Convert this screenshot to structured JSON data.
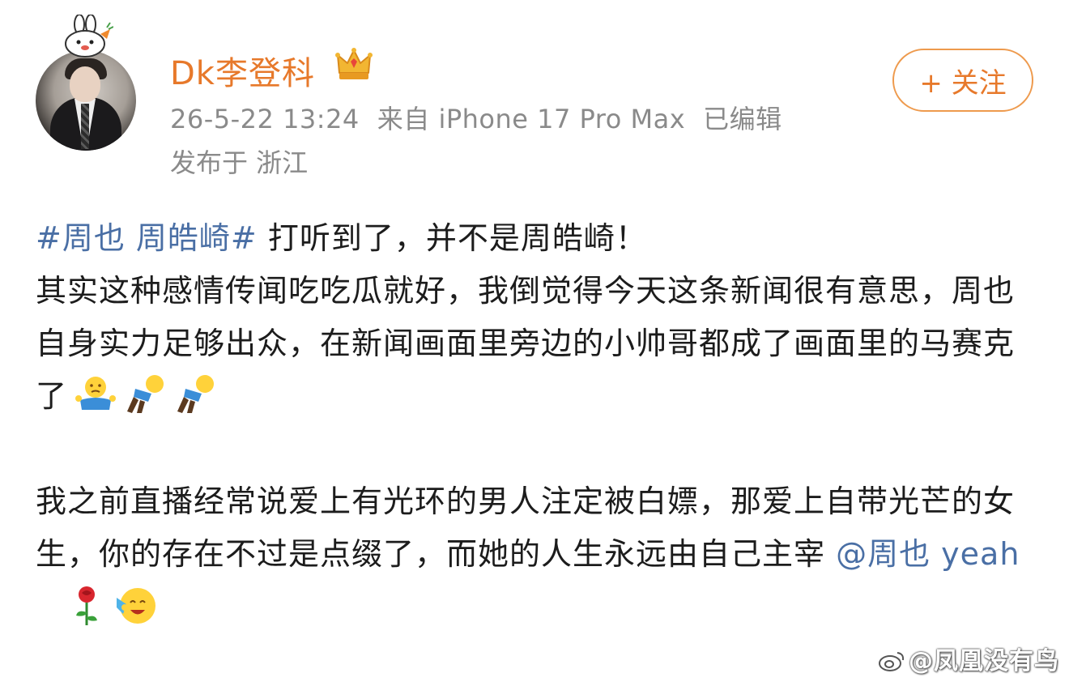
{
  "author": {
    "name": "Dk李登科",
    "crown_badge": "crown-icon",
    "avatar_badge": "rabbit-badge-icon"
  },
  "meta": {
    "timestamp": "26-5-22 13:24",
    "source": "来自 iPhone 17 Pro Max",
    "edited": "已编辑",
    "location": "发布于 浙江"
  },
  "follow_button": {
    "label": "+ 关注"
  },
  "post": {
    "hashtag": "#周也 周皓崎#",
    "line1_text": " 打听到了，并不是周皓崎！",
    "para1_text": "其实这种感情传闻吃吃瓜就好，我倒觉得今天这条新闻很有意思，周也自身实力足够出众，在新闻画面里旁边的小帅哥都成了画面里的马赛克了",
    "para2_text": "我之前直播经常说爱上有光环的男人注定被白嫖，那爱上自带光芒的女生，你的存在不过是点缀了，而她的人生永远由自己主宰 ",
    "mention": "@周也 yeah",
    "emojis_para1": [
      "shrug-emoji",
      "kneel-emoji",
      "kneel-emoji"
    ],
    "emojis_para2": [
      "rose-emoji",
      "cheer-emoji"
    ]
  },
  "watermark": {
    "text": "@凤凰没有鸟",
    "logo": "weibo-logo-icon"
  },
  "colors": {
    "username": "#e7792b",
    "link": "#4a6fa5",
    "meta": "#8a8a8a",
    "follow_border": "#ee9a4d"
  }
}
